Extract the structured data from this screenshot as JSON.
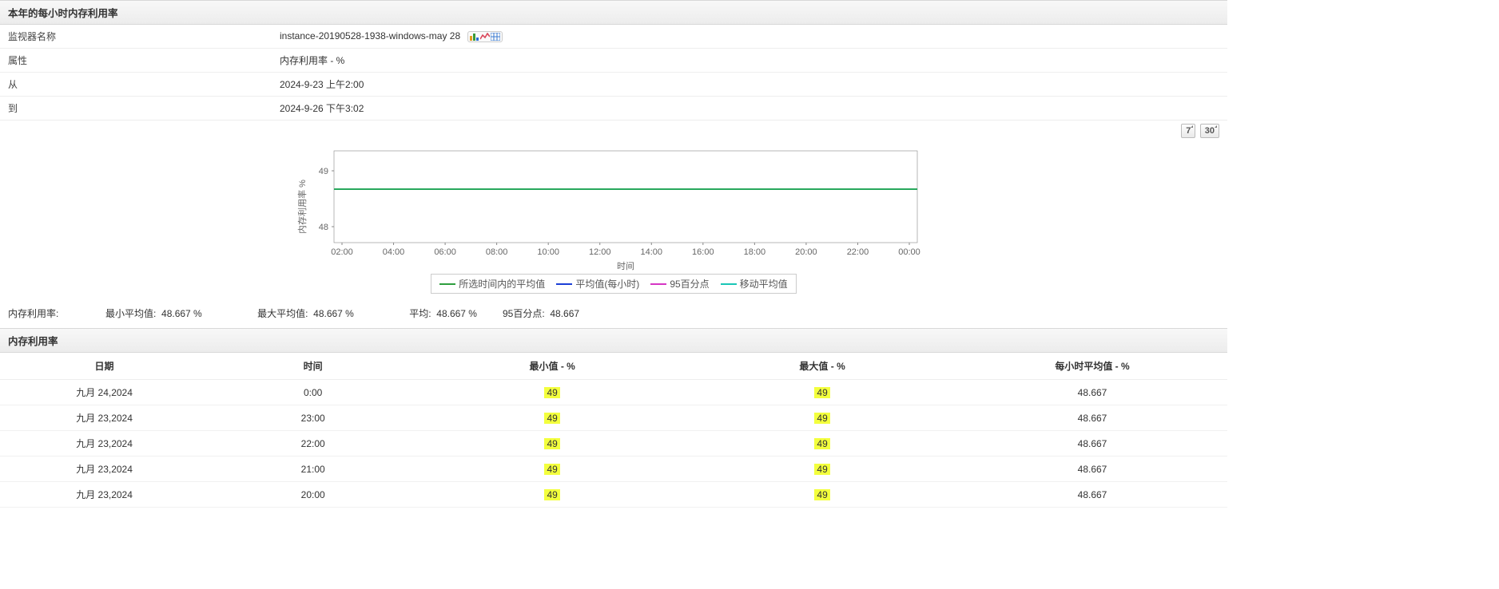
{
  "header1": "本年的每小时内存利用率",
  "info": {
    "monitor_label": "监视器名称",
    "monitor_value": "instance-20190528-1938-windows-may 28",
    "attr_label": "属性",
    "attr_value": "内存利用率 - %",
    "from_label": "从",
    "from_value": "2024-9-23 上午2:00",
    "to_label": "到",
    "to_value": "2024-9-26 下午3:02"
  },
  "range": {
    "r7": "7",
    "r30": "30"
  },
  "chart_data": {
    "type": "line",
    "ylabel": "内存利用率 %",
    "xlabel": "时间",
    "y_ticks": [
      48,
      49
    ],
    "x_ticks": [
      "02:00",
      "04:00",
      "06:00",
      "08:00",
      "10:00",
      "12:00",
      "14:00",
      "16:00",
      "18:00",
      "20:00",
      "22:00",
      "00:00"
    ],
    "series": [
      {
        "name": "所选时间内的平均值",
        "color": "#2e9e3f",
        "value_constant": 48.667
      },
      {
        "name": "平均值(每小时)",
        "color": "#1b3fd6",
        "value_constant": 48.667
      },
      {
        "name": "95百分点",
        "color": "#d536c4",
        "value_constant": 48.667
      },
      {
        "name": "移动平均值",
        "color": "#19c6b6",
        "value_constant": 48.667
      }
    ]
  },
  "stats": {
    "metric": "内存利用率:",
    "min_label": "最小平均值:",
    "min_value": "48.667  %",
    "max_label": "最大平均值:",
    "max_value": "48.667  %",
    "avg_label": "平均:",
    "avg_value": "48.667  %",
    "p95_label": "95百分点:",
    "p95_value": "48.667"
  },
  "header2": "内存利用率",
  "table": {
    "headers": {
      "date": "日期",
      "time": "时间",
      "min": "最小值 - %",
      "max": "最大值 - %",
      "avg": "每小时平均值 - %"
    },
    "rows": [
      {
        "date": "九月 24,2024",
        "time": "0:00",
        "min": "49",
        "max": "49",
        "avg": "48.667"
      },
      {
        "date": "九月 23,2024",
        "time": "23:00",
        "min": "49",
        "max": "49",
        "avg": "48.667"
      },
      {
        "date": "九月 23,2024",
        "time": "22:00",
        "min": "49",
        "max": "49",
        "avg": "48.667"
      },
      {
        "date": "九月 23,2024",
        "time": "21:00",
        "min": "49",
        "max": "49",
        "avg": "48.667"
      },
      {
        "date": "九月 23,2024",
        "time": "20:00",
        "min": "49",
        "max": "49",
        "avg": "48.667"
      }
    ]
  },
  "legend": {
    "l1": "所选时间内的平均值",
    "l2": "平均值(每小时)",
    "l3": "95百分点",
    "l4": "移动平均值"
  }
}
